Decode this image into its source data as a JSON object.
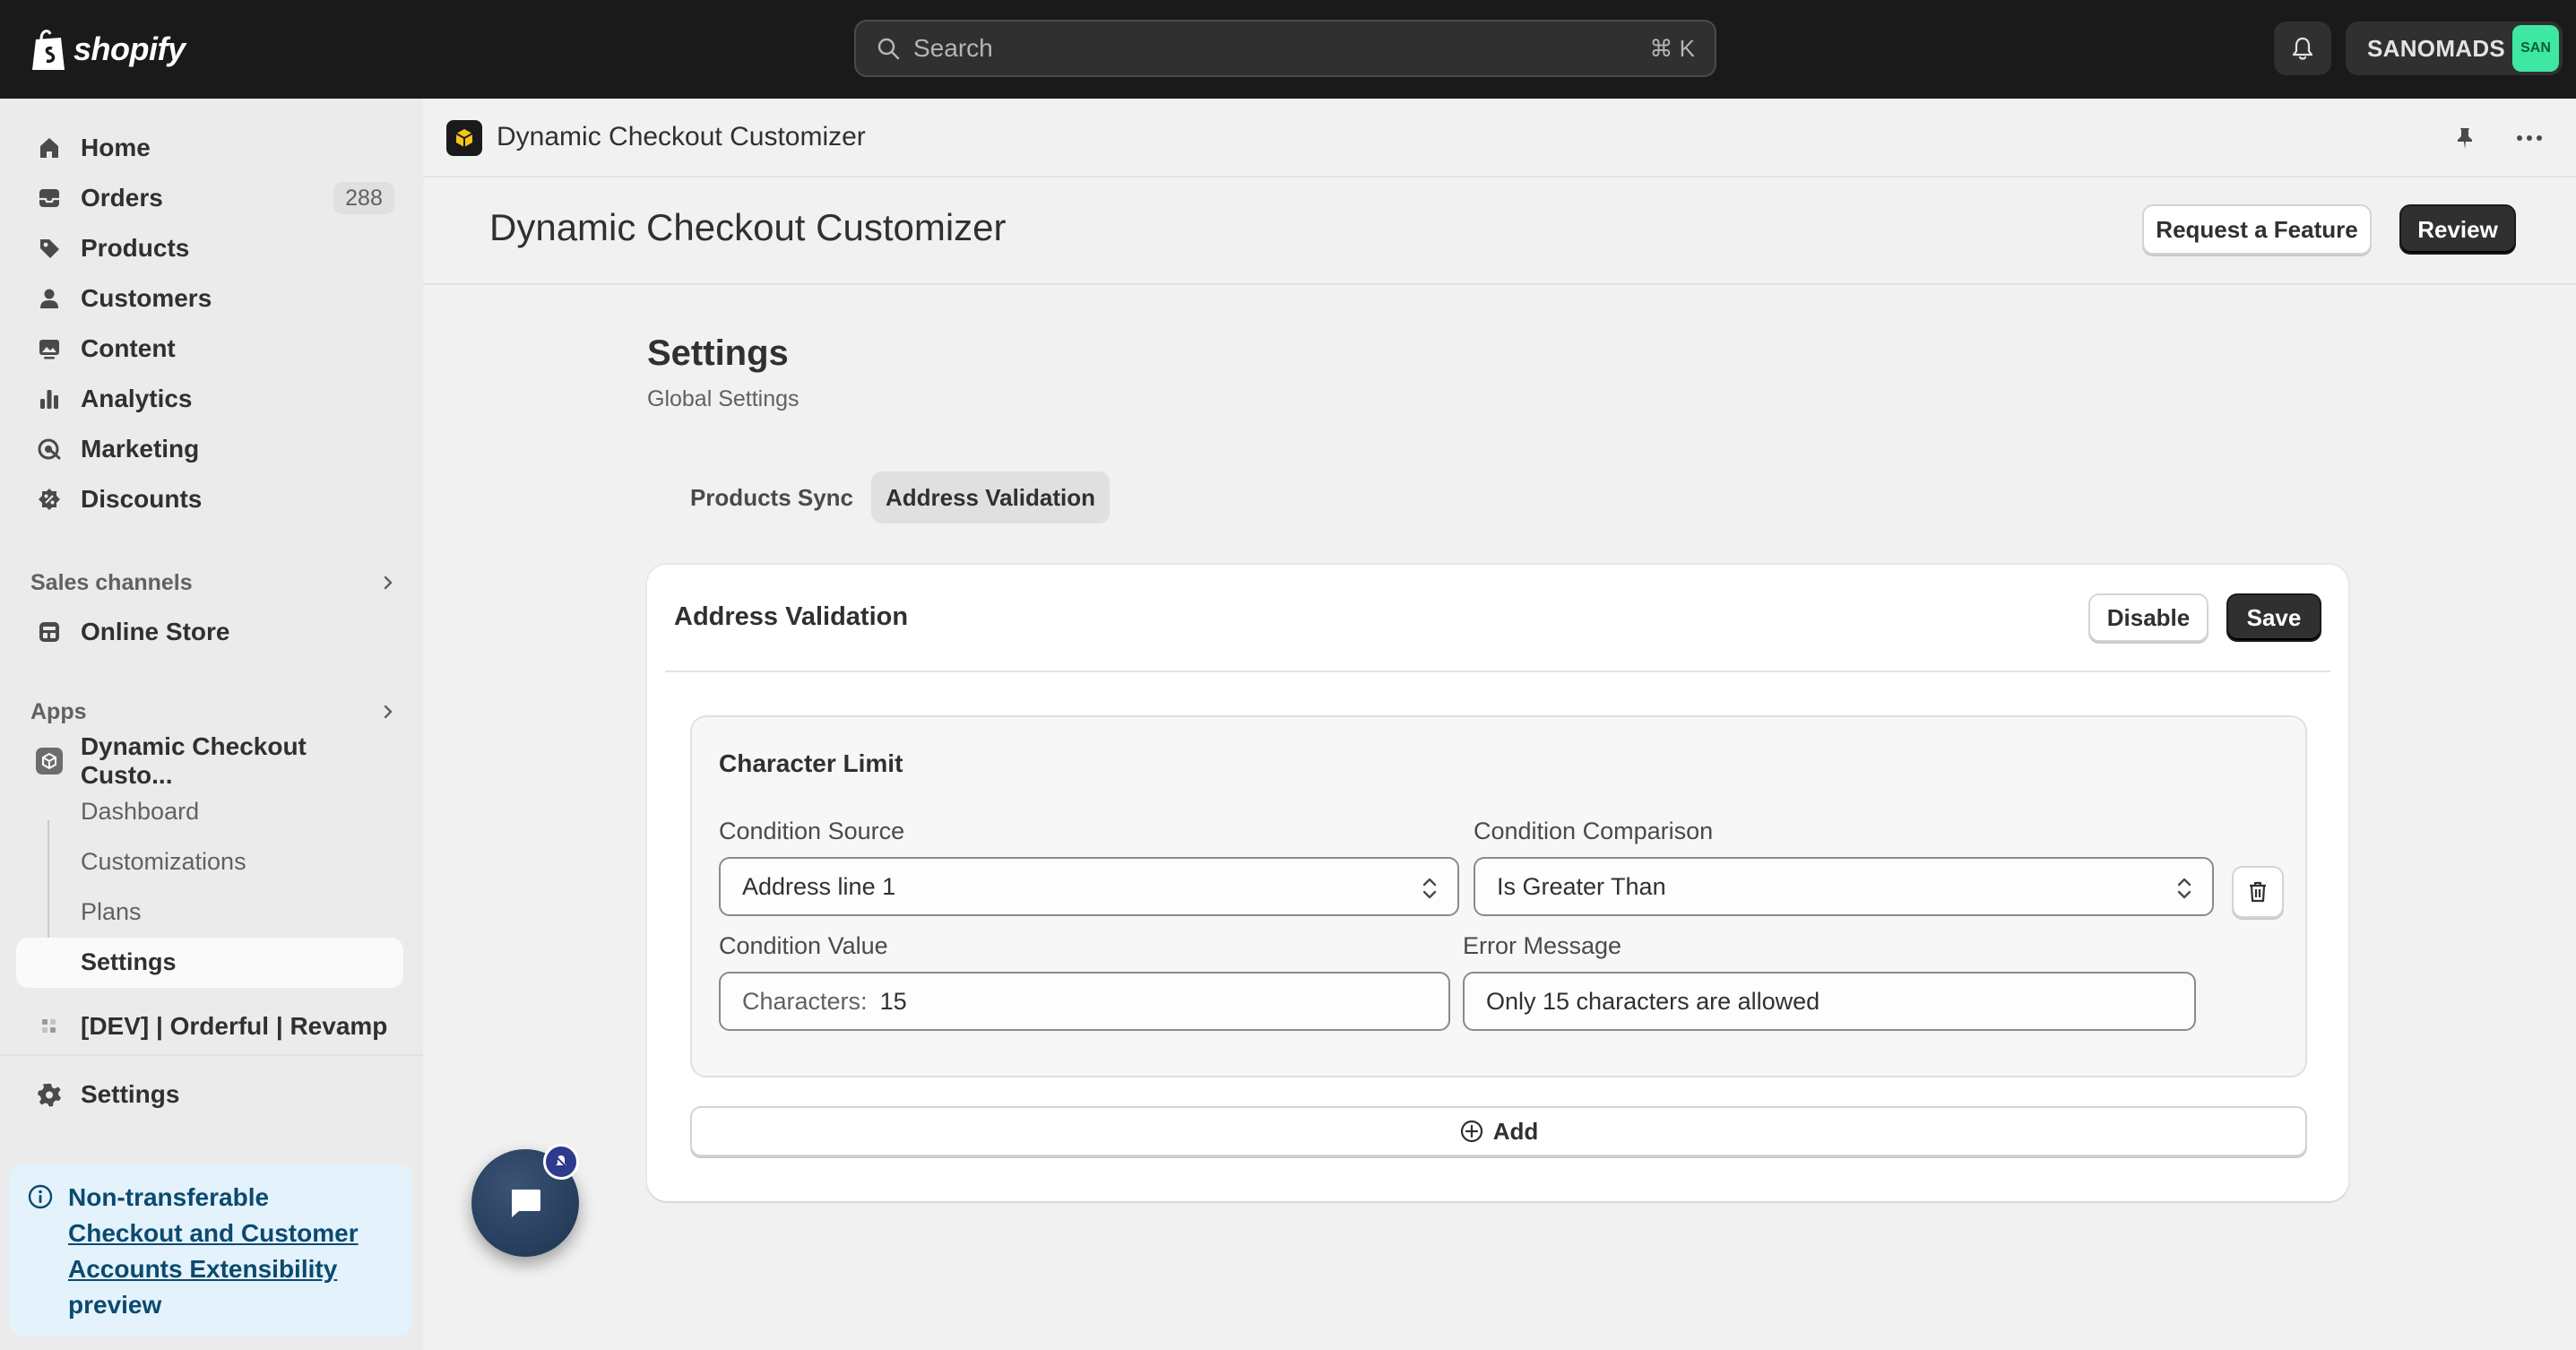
{
  "topbar": {
    "brand": "shopify",
    "search_placeholder": "Search",
    "search_shortcut": "⌘ K",
    "store_name": "SANOMADS",
    "store_initials": "SAN"
  },
  "sidebar": {
    "items": [
      {
        "label": "Home",
        "icon": "home-icon"
      },
      {
        "label": "Orders",
        "icon": "inbox-icon",
        "badge": "288"
      },
      {
        "label": "Products",
        "icon": "tag-icon"
      },
      {
        "label": "Customers",
        "icon": "person-icon"
      },
      {
        "label": "Content",
        "icon": "image-icon"
      },
      {
        "label": "Analytics",
        "icon": "bar-chart-icon"
      },
      {
        "label": "Marketing",
        "icon": "target-icon"
      },
      {
        "label": "Discounts",
        "icon": "discount-icon"
      }
    ],
    "sales_channels_label": "Sales channels",
    "online_store_label": "Online Store",
    "apps_label": "Apps",
    "app_name": "Dynamic Checkout Custo...",
    "app_sub_items": [
      "Dashboard",
      "Customizations",
      "Plans",
      "Settings"
    ],
    "dev_app_name": "[DEV] | Orderful | Revamp",
    "settings_label": "Settings",
    "notice": {
      "prefix": "Non-transferable",
      "link": "Checkout and Customer Accounts Extensibility",
      "suffix": "preview"
    }
  },
  "main": {
    "app_bar_title": "Dynamic Checkout Customizer",
    "page_title": "Dynamic Checkout Customizer",
    "request_feature_label": "Request a Feature",
    "review_label": "Review",
    "settings_title": "Settings",
    "settings_subtitle": "Global Settings",
    "tabs": [
      {
        "label": "Products Sync",
        "active": false
      },
      {
        "label": "Address Validation",
        "active": true
      }
    ],
    "card": {
      "title": "Address Validation",
      "disable_label": "Disable",
      "save_label": "Save",
      "rule": {
        "title": "Character Limit",
        "condition_source_label": "Condition Source",
        "condition_source_value": "Address line 1",
        "condition_comparison_label": "Condition Comparison",
        "condition_comparison_value": "Is Greater Than",
        "condition_value_label": "Condition Value",
        "condition_value_prefix": "Characters:",
        "condition_value_value": "15",
        "error_message_label": "Error Message",
        "error_message_value": "Only 15 characters are allowed"
      },
      "add_label": "Add"
    }
  },
  "colors": {
    "topbar": "#1a1a1a",
    "sidebar": "#ebebeb",
    "primary_button": "#303030",
    "notice_bg": "#e4f2fb",
    "avatar": "#3ee8a3",
    "chat_bubble": "#1d3350"
  }
}
